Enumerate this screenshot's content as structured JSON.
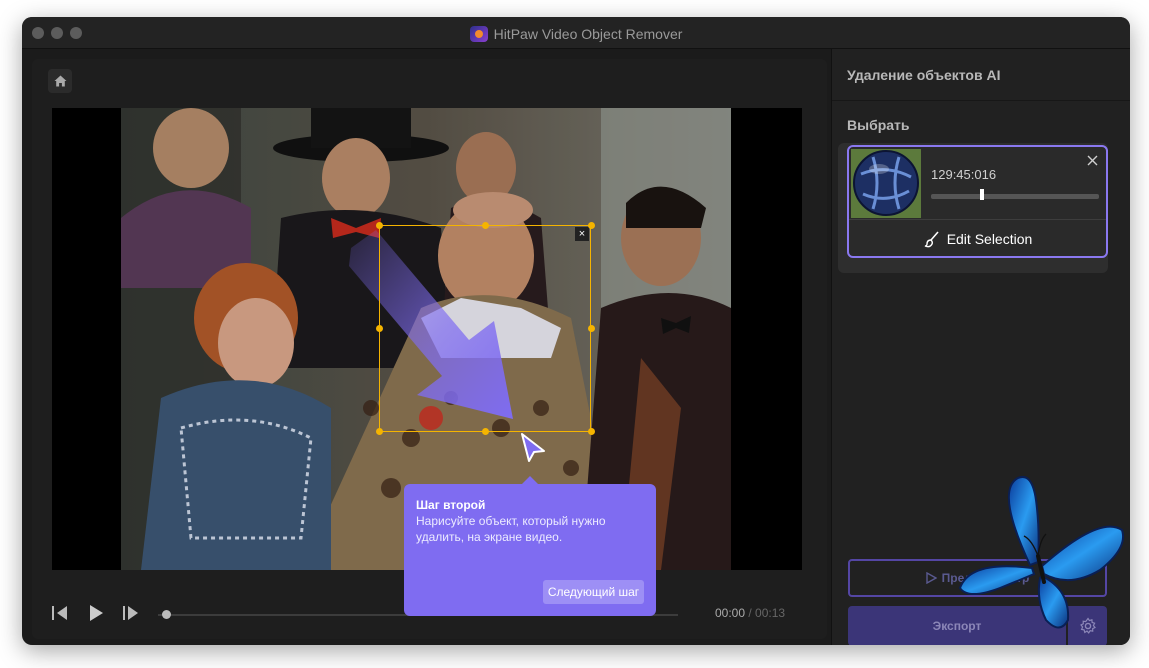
{
  "window": {
    "title": "HitPaw Video Object Remover"
  },
  "sidebar": {
    "panel_title": "Удаление объектов AI",
    "select_label": "Выбрать",
    "selection_card": {
      "timestamp": "129:45:016",
      "timeline_position": 0.3,
      "edit_label": "Edit Selection"
    },
    "preview_label": "Предпросмотр",
    "export_label": "Экспорт"
  },
  "player": {
    "current_time": "00:00",
    "separator": " / ",
    "duration": "00:13",
    "progress": 0.0
  },
  "tooltip": {
    "title": "Шаг второй",
    "body": "Нарисуйте объект, который нужно удалить, на экране видео.",
    "next_label": "Следующий шаг"
  },
  "colors": {
    "accent": "#7f6cf1",
    "selection": "#f5b400",
    "window_bg": "#1b1b1b"
  },
  "icons": [
    "home-icon",
    "close-icon",
    "brush-icon",
    "play-icon",
    "previous-frame-icon",
    "next-frame-icon",
    "gear-icon",
    "mouse-pointer-icon",
    "butterfly-icon"
  ]
}
